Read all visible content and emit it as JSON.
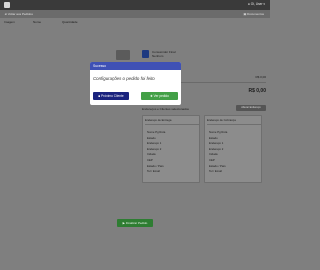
{
  "topbar": {
    "user_label": "● Oi, User ▾"
  },
  "subbar": {
    "left_label": "◄ Voltar aos Pedidos",
    "right_label": "▣ Documentos"
  },
  "table": {
    "headers": [
      "Imagem",
      "Nome",
      "Quantidade"
    ]
  },
  "customer": {
    "line1": "Consumidor Final",
    "line2": "Nenhum"
  },
  "summary": {
    "subtotal_label": "Sub Total",
    "subtotal_value": "R$ 0,00",
    "total_label": "Total",
    "total_value": "R$ 0,00",
    "extra_label": "Endereços e Clientes selecionados"
  },
  "buttons": {
    "dark_label": "Alterar Endereço",
    "bottom_label": "▶ Finalizar Pedido"
  },
  "panels": [
    {
      "title": "Endereço de Entrega",
      "items": [
        "Nome Pg Rota",
        "Estado",
        "Endereço 1",
        "Endereço 2",
        "Cidade",
        "CEP",
        "Estado / País",
        "Tel / Email"
      ]
    },
    {
      "title": "Endereço de Cobrança",
      "items": [
        "Nome Pg Rota",
        "Estado",
        "Endereço 1",
        "Endereço 2",
        "Cidade",
        "CEP",
        "Estado / País",
        "Tel / Email"
      ]
    }
  ],
  "modal": {
    "title": "Sucesso",
    "message": "Configurações o pedido foi feito",
    "btn_primary": "■ Próximo Cliente",
    "btn_success": "✚ Ver pedido"
  }
}
